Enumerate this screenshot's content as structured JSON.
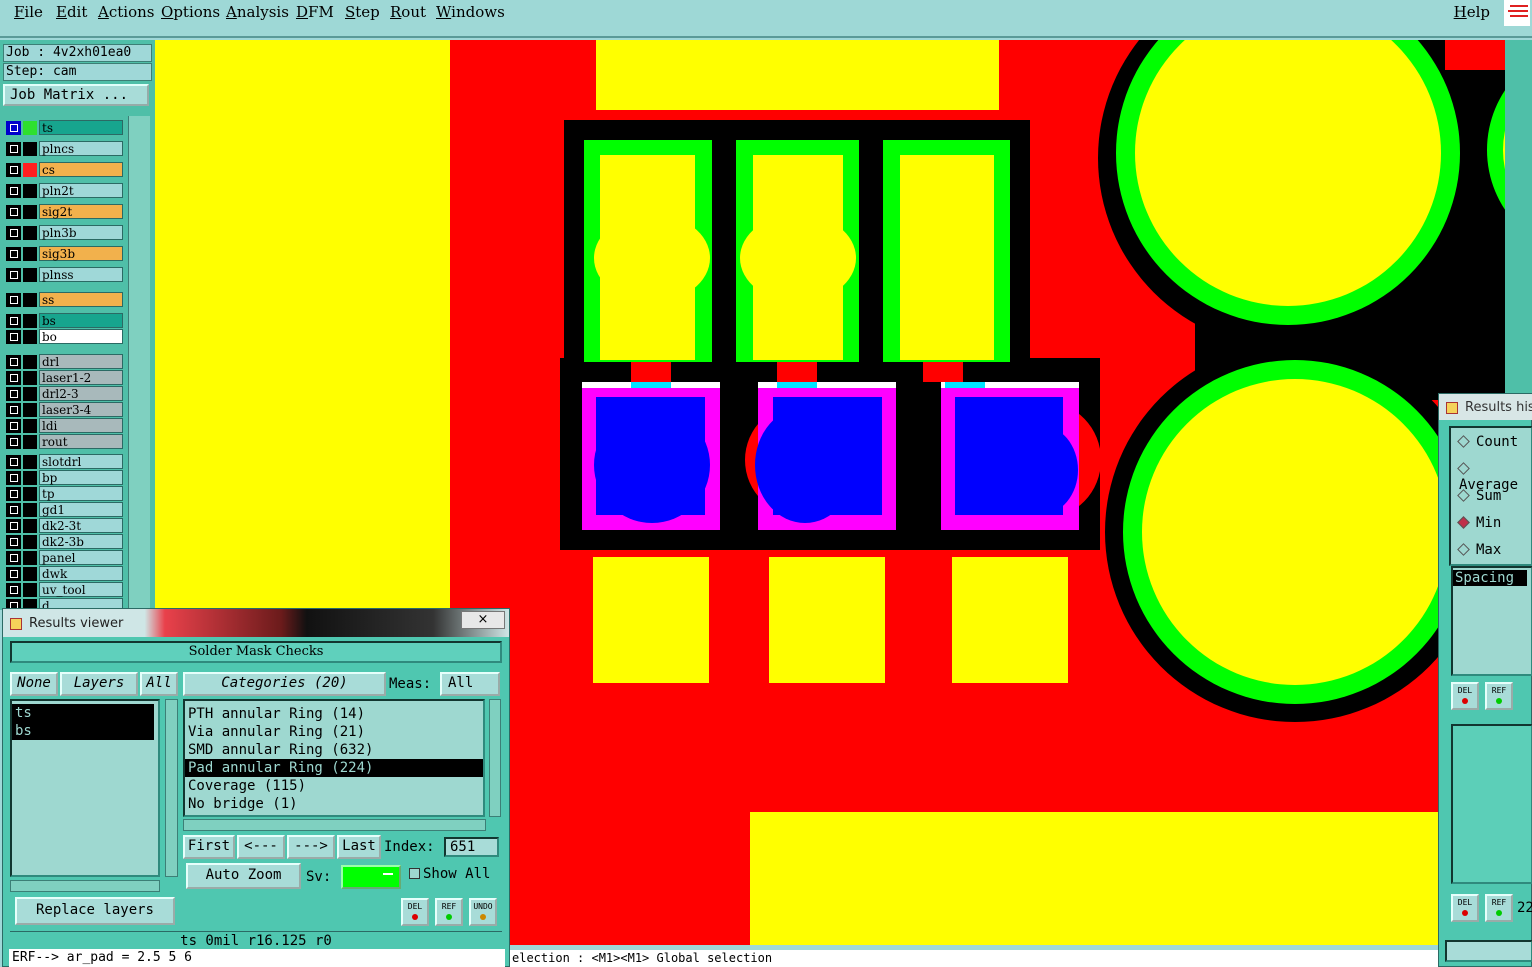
{
  "menu": {
    "items": [
      "File",
      "Edit",
      "Actions",
      "Options",
      "Analysis",
      "DFM",
      "Step",
      "Rout",
      "Windows"
    ],
    "help": "Help"
  },
  "job": {
    "job_line": "Job : 4v2xh01ea0",
    "step_line": "Step: cam",
    "matrix_button": "Job Matrix ..."
  },
  "layers": [
    {
      "name": "ts",
      "style": "teal",
      "swatch": "#2ee02e"
    },
    {
      "name": "plncs",
      "style": "plain"
    },
    {
      "name": "cs",
      "style": "orange",
      "swatch": "#ff2020"
    },
    {
      "name": "pln2t",
      "style": "plain"
    },
    {
      "name": "sig2t",
      "style": "orange"
    },
    {
      "name": "pln3b",
      "style": "plain"
    },
    {
      "name": "sig3b",
      "style": "orange"
    },
    {
      "name": "plnss",
      "style": "plain"
    },
    {
      "name": "ss",
      "style": "orange"
    },
    {
      "name": "bs",
      "style": "teal"
    },
    {
      "name": "bo",
      "style": "white"
    },
    {
      "name": "drl",
      "style": "gray"
    },
    {
      "name": "laser1-2",
      "style": "gray"
    },
    {
      "name": "drl2-3",
      "style": "gray"
    },
    {
      "name": "laser3-4",
      "style": "gray"
    },
    {
      "name": "ldi",
      "style": "gray"
    },
    {
      "name": "rout",
      "style": "gray"
    },
    {
      "name": "slotdrl",
      "style": "plain"
    },
    {
      "name": "bp",
      "style": "plain"
    },
    {
      "name": "tp",
      "style": "plain"
    },
    {
      "name": "gd1",
      "style": "plain"
    },
    {
      "name": "dk2-3t",
      "style": "plain"
    },
    {
      "name": "dk2-3b",
      "style": "plain"
    },
    {
      "name": "panel",
      "style": "plain"
    },
    {
      "name": "dwk",
      "style": "plain"
    },
    {
      "name": "uv_tool",
      "style": "plain"
    },
    {
      "name": "d",
      "style": "plain"
    }
  ],
  "results_viewer": {
    "title": "Results viewer",
    "close": "×",
    "header": "Solder Mask Checks",
    "none_btn": "None",
    "layers_btn": "Layers",
    "all_btn": "All",
    "layer_items": [
      "ts",
      "bs"
    ],
    "categories_btn": "Categories (20)",
    "meas_label": "Meas:",
    "meas_value": "All",
    "categories": [
      "PTH annular Ring (14)",
      "Via annular Ring (21)",
      "SMD annular Ring (632)",
      "Pad annular Ring (224)",
      "Coverage (115)",
      "No bridge (1)"
    ],
    "selected_category": 3,
    "first_btn": "First",
    "prev_btn": "<---",
    "next_btn": "--->",
    "last_btn": "Last",
    "index_label": "Index:",
    "index_value": "651",
    "auto_zoom": "Auto Zoom",
    "sv_label": "Sv:",
    "show_all": "Show All",
    "replace_layers": "Replace layers",
    "del": "DEL",
    "ref": "REF",
    "undo": "UNDO",
    "status": "ts 0mil  r16.125  r0",
    "erf": "ERF--> ar_pad = 2.5 5 6"
  },
  "status_line": "election : <M1><M1> Global selection",
  "histogram": {
    "title": "Results histo",
    "options": [
      "Count",
      "Average",
      "Sum",
      "Min",
      "Max"
    ],
    "selected_option": "Min",
    "list_item": "Spacing",
    "del": "DEL",
    "ref": "REF",
    "number": "22"
  },
  "colors": {
    "canvas_bg": "#ff0000",
    "copper": "#ffff00",
    "mask": "#00ff00",
    "clearance": "#000000",
    "pad_fill": "#0000ff",
    "pad_ring": "#ff00ff",
    "highlight": "#00e5ff"
  }
}
